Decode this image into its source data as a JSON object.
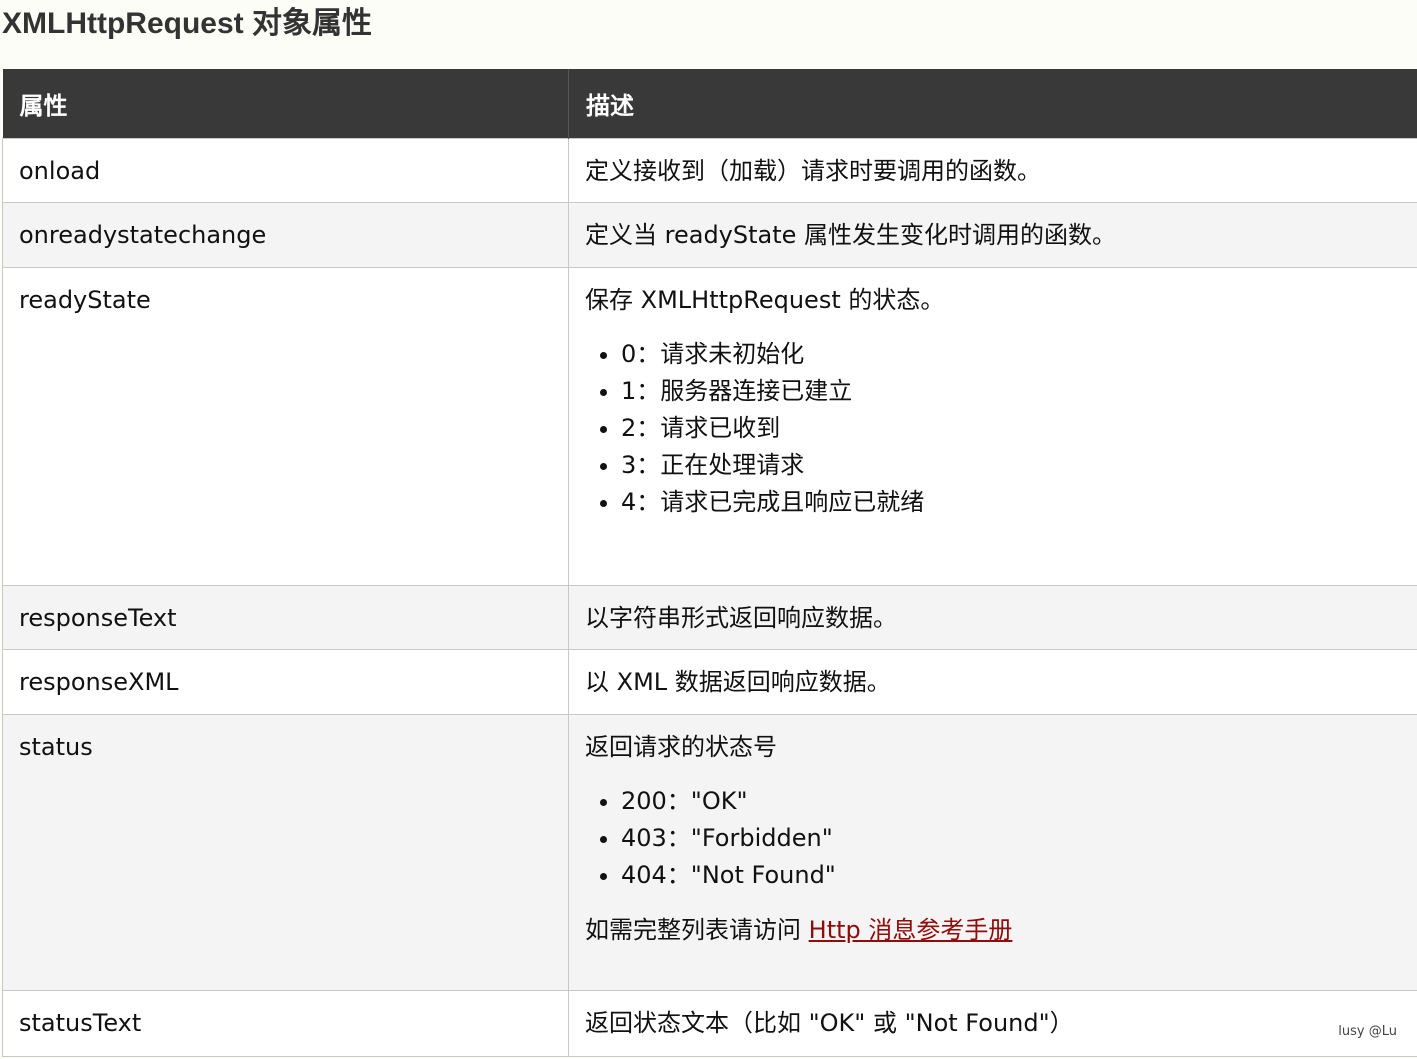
{
  "title": "XMLHttpRequest 对象属性",
  "table": {
    "headers": [
      "属性",
      "描述"
    ],
    "rows": [
      {
        "name": "onload",
        "desc": "定义接收到（加载）请求时要调用的函数。"
      },
      {
        "name": "onreadystatechange",
        "desc": "定义当 readyState 属性发生变化时调用的函数。"
      },
      {
        "name": "readyState",
        "desc": "保存 XMLHttpRequest 的状态。",
        "items": [
          "0：请求未初始化",
          "1：服务器连接已建立",
          "2：请求已收到",
          "3：正在处理请求",
          "4：请求已完成且响应已就绪"
        ]
      },
      {
        "name": "responseText",
        "desc": "以字符串形式返回响应数据。"
      },
      {
        "name": "responseXML",
        "desc": "以 XML 数据返回响应数据。"
      },
      {
        "name": "status",
        "desc": "返回请求的状态号",
        "items": [
          "200：\"OK\"",
          "403：\"Forbidden\"",
          "404：\"Not Found\""
        ],
        "note_prefix": "如需完整列表请访问 ",
        "note_link": "Http 消息参考手册"
      },
      {
        "name": "statusText",
        "desc": "返回状态文本（比如 \"OK\" 或 \"Not Found\"）"
      }
    ]
  },
  "watermark": "lusy @Lu",
  "colors": {
    "header_bg": "#393939",
    "link": "#900b09",
    "row_alt": "#f4f4f4"
  }
}
